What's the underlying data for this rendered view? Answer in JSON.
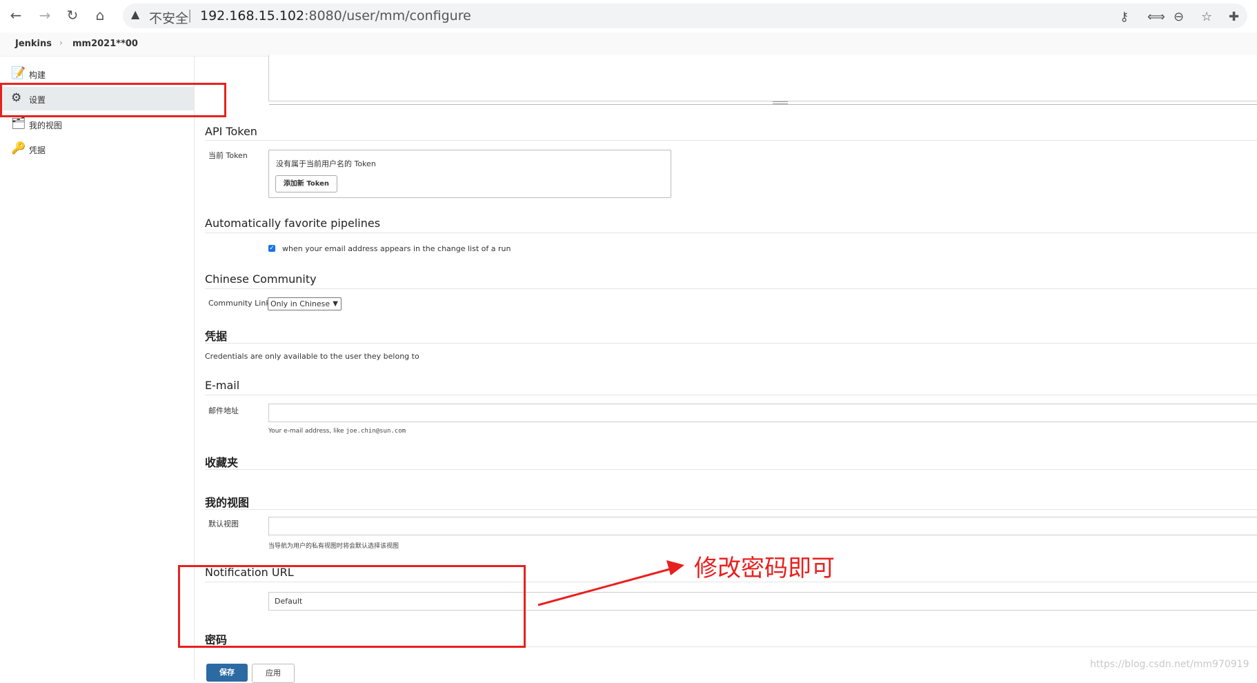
{
  "browser": {
    "security_warning": "不安全",
    "separator": "|",
    "url_host": "192.168.15.102",
    "url_rest": ":8080/user/mm/configure",
    "icons": [
      "back-icon",
      "forward-icon",
      "reload-icon",
      "home-icon",
      "warning-icon",
      "key-icon",
      "translate-icon",
      "zoom-icon",
      "star-icon",
      "extensions-icon"
    ]
  },
  "breadcrumb": {
    "items": [
      "Jenkins",
      "mm2021**00"
    ],
    "separator": "›"
  },
  "sidebar": {
    "items": [
      {
        "label": "构建",
        "icon": "notepad-icon"
      },
      {
        "label": "设置",
        "icon": "gear-icon"
      },
      {
        "label": "我的视图",
        "icon": "views-icon"
      },
      {
        "label": "凭据",
        "icon": "credentials-icon"
      }
    ]
  },
  "sections": {
    "api_token": {
      "title": "API Token",
      "label": "当前 Token",
      "empty_text": "没有属于当前用户名的 Token",
      "add_button": "添加新 Token"
    },
    "auto_favorite": {
      "title": "Automatically favorite pipelines",
      "checkbox_label": "when your email address appears in the change list of a run",
      "checked": true
    },
    "chinese_community": {
      "title": "Chinese Community",
      "label": "Community Link",
      "selected": "Only in Chinese"
    },
    "credentials": {
      "title": "凭据",
      "text": "Credentials are only available to the user they belong to"
    },
    "email": {
      "title": "E-mail",
      "label": "邮件地址",
      "value": "",
      "hint_prefix": "Your e-mail address, like ",
      "hint_example": "joe.chin@sun.com"
    },
    "favorites": {
      "title": "收藏夹"
    },
    "my_views": {
      "title": "我的视图",
      "label": "默认视图",
      "value": "",
      "hint": "当导航为用户的私有视图时将会默认选择该视图"
    },
    "notification": {
      "title": "Notification URL",
      "value": "Default"
    },
    "password": {
      "title": "密码"
    }
  },
  "buttons": {
    "save": "保存",
    "apply": "应用"
  },
  "annotation": {
    "text": "修改密码即可",
    "color": "#e8201e"
  },
  "watermark": "https://blog.csdn.net/mm970919"
}
